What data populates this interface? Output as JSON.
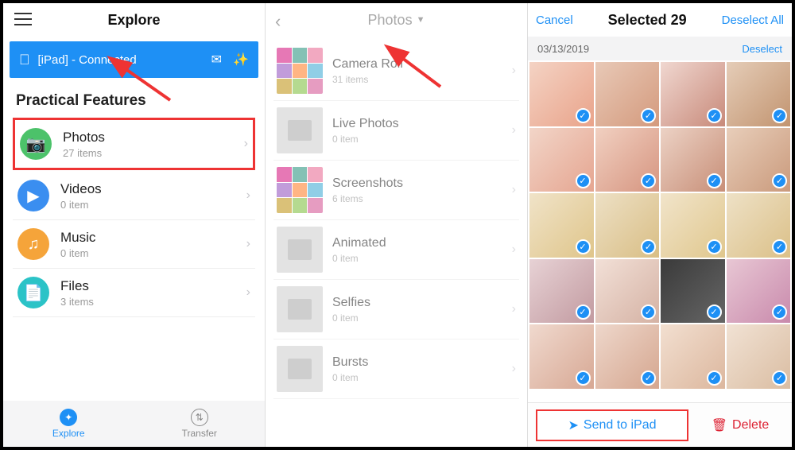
{
  "pane1": {
    "title": "Explore",
    "connection": "[iPad] - Connected",
    "section_title": "Practical Features",
    "features": [
      {
        "label": "Photos",
        "sub": "27 items"
      },
      {
        "label": "Videos",
        "sub": "0 item"
      },
      {
        "label": "Music",
        "sub": "0 item"
      },
      {
        "label": "Files",
        "sub": "3 items"
      }
    ],
    "tabs": {
      "explore": "Explore",
      "transfer": "Transfer"
    }
  },
  "pane2": {
    "title": "Photos",
    "albums": [
      {
        "label": "Camera Roll",
        "sub": "31 items"
      },
      {
        "label": "Live Photos",
        "sub": "0 item"
      },
      {
        "label": "Screenshots",
        "sub": "6 items"
      },
      {
        "label": "Animated",
        "sub": "0 item"
      },
      {
        "label": "Selfies",
        "sub": "0 item"
      },
      {
        "label": "Bursts",
        "sub": "0 item"
      }
    ]
  },
  "pane3": {
    "cancel": "Cancel",
    "title": "Selected 29",
    "deselect_all": "Deselect All",
    "date": "03/13/2019",
    "deselect": "Deselect",
    "send": "Send to iPad",
    "delete": "Delete"
  }
}
